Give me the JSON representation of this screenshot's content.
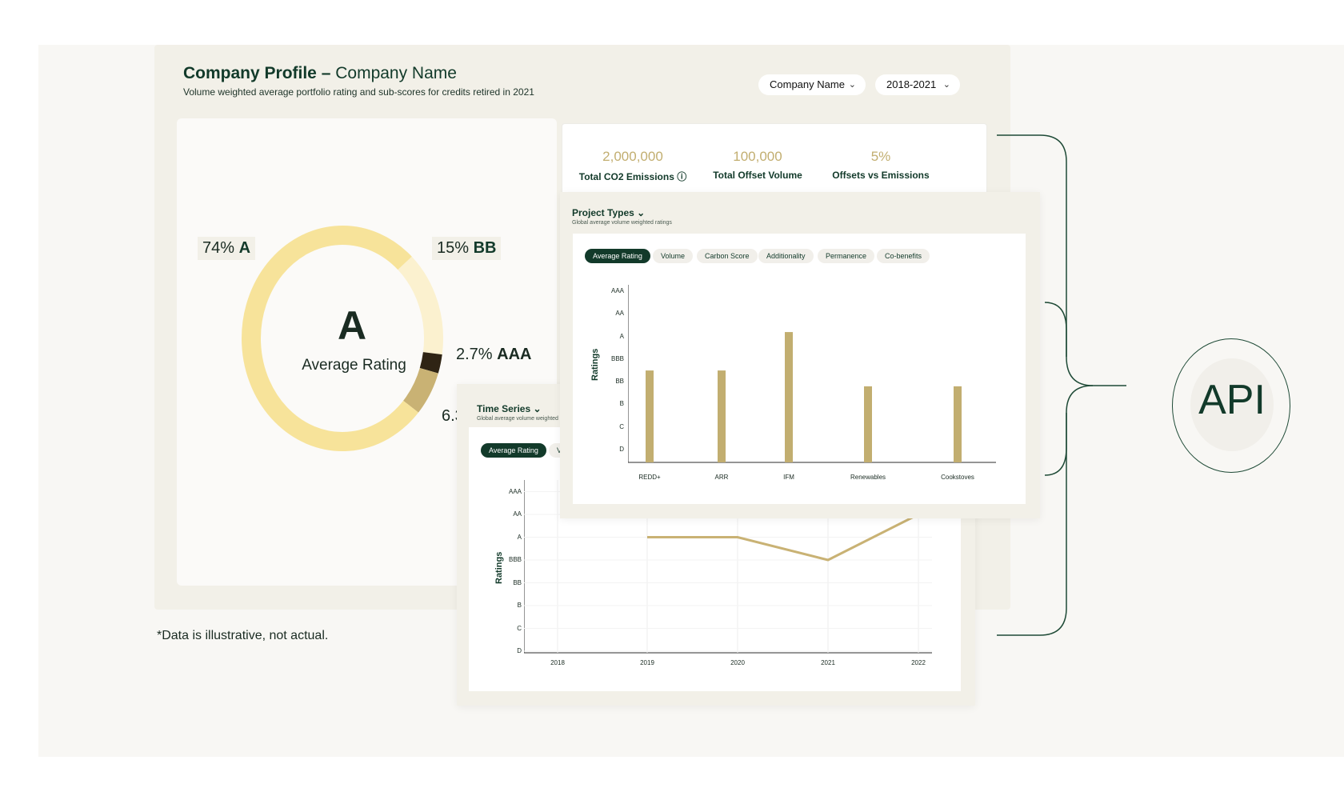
{
  "profile": {
    "title_bold": "Company Profile –",
    "title_light": " Company Name",
    "subtitle": "Volume weighted average portfolio rating and sub-scores for credits retired in 2021",
    "company_select": "Company Name",
    "period_select": "2018-2021"
  },
  "donut": {
    "letter": "A",
    "label": "Average Rating",
    "segments": [
      {
        "pct": "74%",
        "grade": "A",
        "value": 74,
        "color": "#f7e39a"
      },
      {
        "pct": "15%",
        "grade": "BB",
        "value": 15,
        "color": "#fbf1cf"
      },
      {
        "pct": "2.7%",
        "grade": "AAA",
        "value": 2.7,
        "color": "#2f2414"
      },
      {
        "pct": "6.3",
        "grade": "",
        "value": 6.3,
        "color": "#c9b274"
      }
    ]
  },
  "kpis": [
    {
      "value": "2,000,000",
      "label": "Total CO2 Emissions ⓘ"
    },
    {
      "value": "100,000",
      "label": "Total Offset Volume"
    },
    {
      "value": "5%",
      "label": "Offsets  vs Emissions"
    }
  ],
  "project_types": {
    "title": "Project Types ⌄",
    "subtitle": "Global average volume weighted ratings",
    "tabs": [
      "Average Rating",
      "Volume",
      "Carbon Score",
      "Additionality",
      "Permanence",
      "Co-benefits"
    ],
    "axis_title": "Ratings"
  },
  "time_series": {
    "title": "Time Series ⌄",
    "subtitle": "Global average volume weighted r",
    "tabs": [
      "Average Rating",
      "V"
    ],
    "axis_title": "Ratings"
  },
  "note": "*Data is illustrative, not actual.",
  "api_label": "API",
  "colors": {
    "accent": "#123a2a",
    "gold": "#c2ae70",
    "bg": "#f2f0e8"
  },
  "chart_data": [
    {
      "type": "bar",
      "title": "Project Types",
      "ylabel": "Ratings",
      "y_ticks": [
        "D",
        "C",
        "B",
        "BB",
        "BBB",
        "A",
        "AA",
        "AAA"
      ],
      "categories": [
        "REDD+",
        "ARR",
        "IFM",
        "Renewables",
        "Cookstoves"
      ],
      "values": [
        "BB",
        "BB",
        "A",
        "B",
        "B"
      ],
      "values_numeric": [
        3.5,
        3.5,
        5.2,
        2.8,
        2.8
      ]
    },
    {
      "type": "line",
      "title": "Time Series",
      "ylabel": "Ratings",
      "y_ticks": [
        "D",
        "C",
        "B",
        "BB",
        "BBB",
        "A",
        "AA",
        "AAA"
      ],
      "x": [
        "2018",
        "2019",
        "2020",
        "2021",
        "2022"
      ],
      "series": [
        {
          "values": [
            null,
            5,
            5,
            4,
            6
          ]
        }
      ]
    }
  ]
}
